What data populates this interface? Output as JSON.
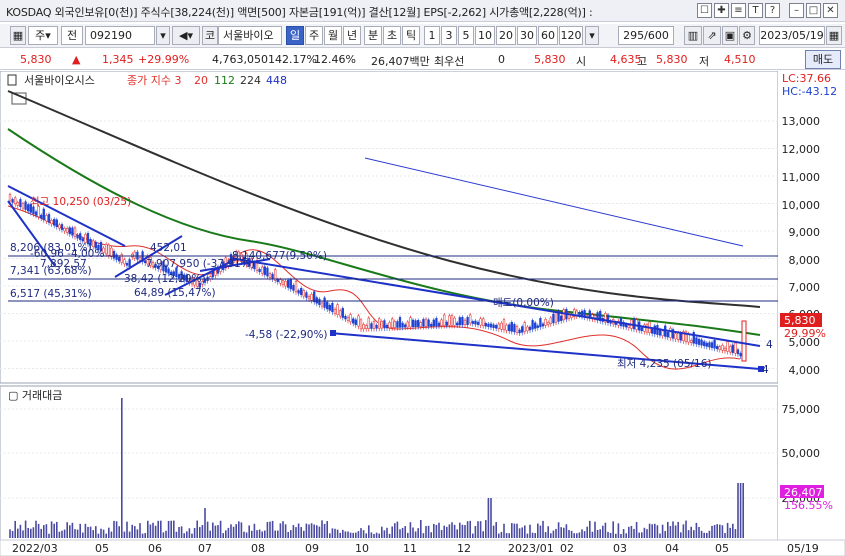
{
  "header": {
    "info": "KOSDAQ 외국인보유[0(천)] 주식수[38,224(천)] 액면[500] 자본금[191(억)] 결산[12월] EPS[-2,262] 시가총액[2,228(억)] :",
    "buttons": [
      "☐",
      "✚",
      "≡",
      "T",
      "?",
      "–",
      "□",
      "✕"
    ]
  },
  "toolbar": {
    "type_select": "주",
    "prev_label": "전",
    "code": "092190",
    "name_prefix": "코",
    "name": "서울바이오",
    "periods": [
      "일",
      "주",
      "월",
      "년",
      "분",
      "초",
      "틱"
    ],
    "minutes": [
      "1",
      "3",
      "5",
      "10",
      "20",
      "30",
      "60",
      "120"
    ],
    "counter": "295/600",
    "date": "2023/05/19"
  },
  "quote": {
    "price": "5,830",
    "change": "1,345",
    "change_pct": "+29.99%",
    "volume": "4,763,050",
    "volume_ratio": "142.17%",
    "turnover": "12.46%",
    "amount": "26,407백만",
    "pref_label": "최우선",
    "pref_value": "0",
    "price2": "5,830",
    "open_label": "시",
    "open": "4,635",
    "high_label": "고",
    "high": "5,830",
    "low_label": "저",
    "low": "4,510",
    "buy_button": "매수",
    "sell_button": "매도"
  },
  "chart": {
    "title": "서울바이오시스",
    "ma_label": "종가 지수 3",
    "ma_periods": [
      "20",
      "112",
      "224",
      "448"
    ],
    "lc": "LC:37.66",
    "hc": "HC:-43.12",
    "price_axis": [
      "13,000",
      "12,000",
      "11,000",
      "10,000",
      "9,000",
      "8,000",
      "7,000",
      "6,000",
      "5,000",
      "4,000"
    ],
    "price_tag": "5,830",
    "price_pct_tag": "29.99%",
    "vol_title": "거래대금",
    "vol_axis": [
      "75,000",
      "50,000",
      "25,000"
    ],
    "vol_tag": "26,407",
    "vol_pct_tag": "156.55%",
    "x_labels": [
      "2022/03",
      "05",
      "06",
      "07",
      "08",
      "09",
      "10",
      "11",
      "12",
      "2023/01",
      "02",
      "03",
      "04",
      "05",
      "05/19"
    ],
    "annotations": {
      "high": "최고 10,250 (03/25)",
      "low": "최저 4,235 (05/16)",
      "lvl1": "8,206 (83,01%)",
      "lvl2": "7,341 (63,68%)",
      "lvl3": "6,517 (45,31%)",
      "a1": "452,01",
      "a2": "-60,96 -4,00%",
      "a3": "7,892,57",
      "a4": "7,907,950 (-37,91%)",
      "a5": "8,140,677(9,50%)",
      "a6": "38,42 (12,29%)",
      "a7": "64,89 (15,47%)",
      "a8": "-4,58 (-22,90%)",
      "a9": "매도(0,00%)",
      "right4": "4",
      "right4b": "4"
    },
    "colors": {
      "ma20": "#e0302a",
      "ma112": "#1a7a1a",
      "ma224": "#303030",
      "trend": "#1e32c8",
      "up": "#e01e1e",
      "down": "#1e42d2",
      "volume": "#4a4aa0",
      "price_tag": "#e01e1e",
      "vol_tag": "#e020e0"
    }
  }
}
